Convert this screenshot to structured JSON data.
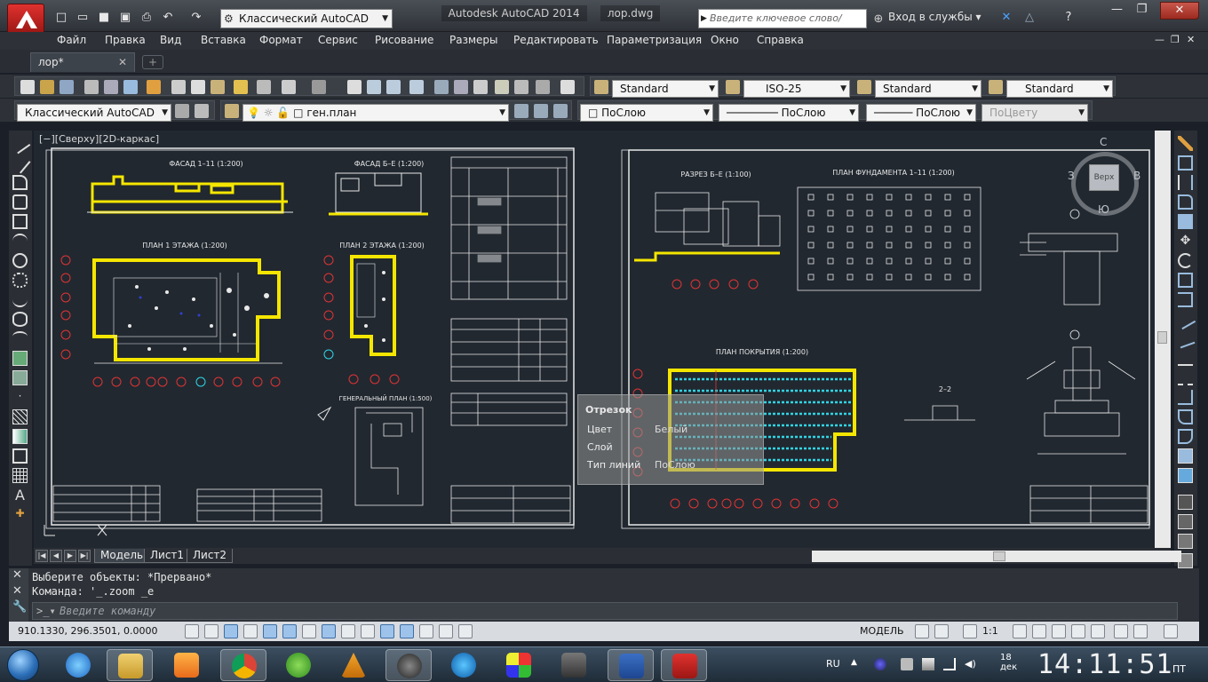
{
  "titlebar": {
    "workspace": "Классический AutoCAD",
    "app_name": "Autodesk AutoCAD 2014",
    "file_name": "лор.dwg",
    "search_placeholder": "Введите ключевое слово/фразу",
    "signin": "Вход в службы"
  },
  "menu": [
    "Файл",
    "Правка",
    "Вид",
    "Вставка",
    "Формат",
    "Сервис",
    "Рисование",
    "Размеры",
    "Редактировать",
    "Параметризация",
    "Окно",
    "Справка"
  ],
  "file_tab": "лор*",
  "styles_toolbar": {
    "text_style": "Standard",
    "dim_style": "ISO-25",
    "table_style": "Standard",
    "mleader_style": "Standard"
  },
  "layers_toolbar": {
    "workspace": "Классический AutoCAD",
    "layer": "ген.план",
    "color": "ПоСлою",
    "linetype": "ПоСлою",
    "lineweight": "ПоСлою",
    "plotstyle": "ПоЦвету"
  },
  "viewport_label": "[−][Сверху][2D-каркас]",
  "viewcube": {
    "top": "Верх",
    "north": "С",
    "south": "Ю",
    "west": "З",
    "east": "В"
  },
  "drawing_titles": {
    "facade_1_11": "ФАСАД 1–11 (1:200)",
    "facade_b_e": "ФАСАД Б–Е (1:200)",
    "plan_floor1": "ПЛАН 1 ЭТАЖА (1:200)",
    "plan_floor2": "ПЛАН 2 ЭТАЖА (1:200)",
    "section": "РАЗРЕЗ Б–Е (1:100)",
    "foundation": "ПЛАН ФУНДАМЕНТА 1–11 (1:200)",
    "roof": "ПЛАН ПОКРЫТИЯ (1:200)",
    "section_2_2": "2–2",
    "genplan": "ГЕНЕРАЛЬНЫЙ ПЛАН (1:500)"
  },
  "tooltip": {
    "title": "Отрезок",
    "rows": [
      {
        "label": "Цвет",
        "value": "Белый"
      },
      {
        "label": "Слой",
        "value": ""
      },
      {
        "label": "Тип линий",
        "value": "ПоСлою"
      }
    ]
  },
  "layout_tabs": [
    "Модель",
    "Лист1",
    "Лист2"
  ],
  "command": {
    "history1": "Выберите объекты: *Прервано*",
    "history2": "Команда: '_.zoom _e",
    "placeholder": "Введите команду"
  },
  "status": {
    "coords": "910.1330, 296.3501, 0.0000",
    "model": "МОДЕЛЬ",
    "scale": "1:1"
  },
  "taskbar": {
    "lang": "RU",
    "date": "18\nдек",
    "time": "14:11:51",
    "time_suffix": "ПТ"
  },
  "colors": {
    "background": "#212830",
    "highlight_yellow": "#f5e600",
    "cyan": "#2fd6e6",
    "red_axis": "#e03434",
    "drawing_white": "#e8e8e8"
  }
}
